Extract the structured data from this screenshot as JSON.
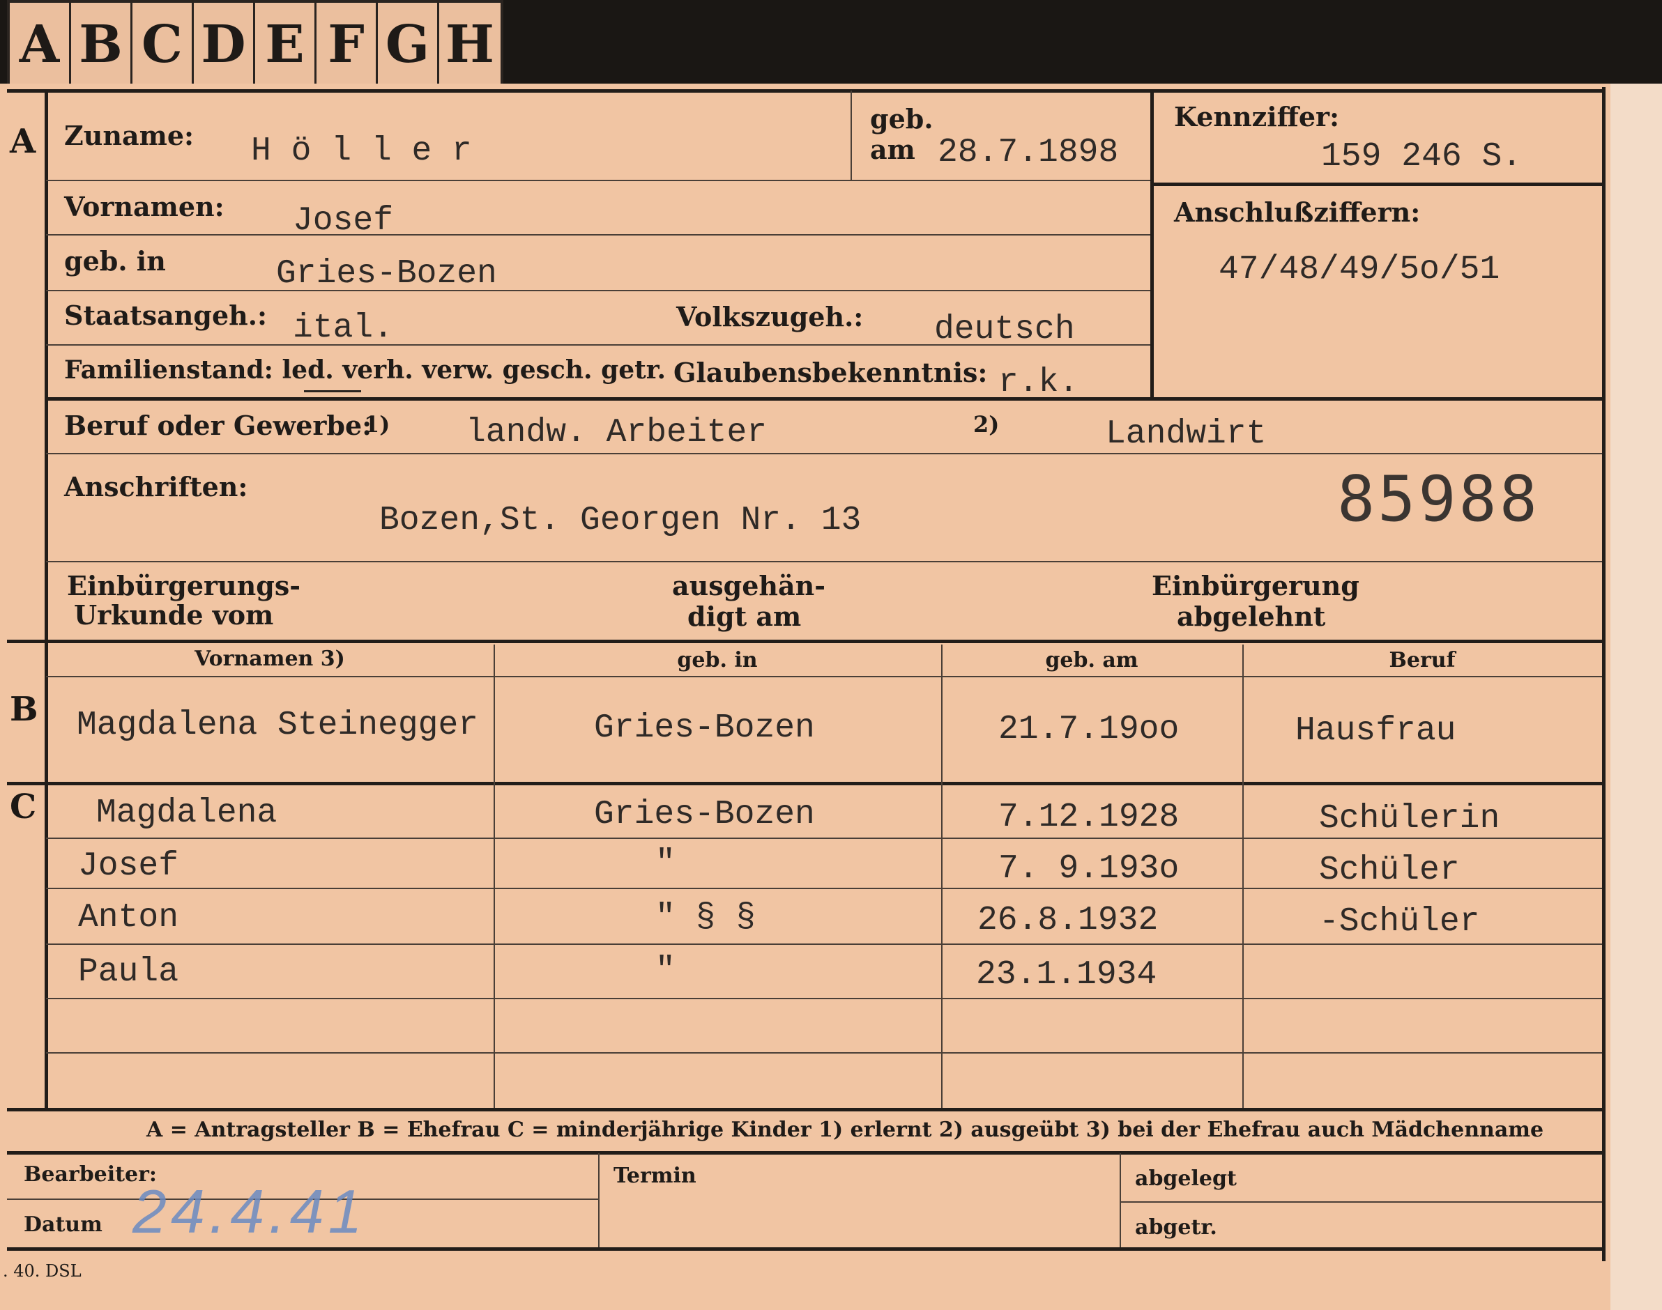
{
  "tabs": [
    "A",
    "B",
    "C",
    "D",
    "E",
    "F",
    "G",
    "H"
  ],
  "section_letters": {
    "a": "A",
    "b": "B",
    "c": "C"
  },
  "labels": {
    "zuname": "Zuname:",
    "geb": "geb.",
    "am": "am",
    "kennziffer": "Kennziffer:",
    "vornamen": "Vornamen:",
    "geb_in": "geb. in",
    "anschlussziffern": "Anschlußziffern:",
    "staatsangeh": "Staatsangeh.:",
    "volkszugeh": "Volkszugeh.:",
    "familienstand": "Familienstand: led. verh. verw. gesch. getr.",
    "glaubensbekenntnis": "Glaubensbekenntnis:",
    "beruf": "Beruf oder Gewerbe:",
    "fn1": "1)",
    "fn2": "2)",
    "anschriften": "Anschriften:",
    "einb_urkunde_1": "Einbürgerungs-",
    "einb_urkunde_2": "Urkunde vom",
    "ausgehaendigt_1": "ausgehän-",
    "ausgehaendigt_2": "digt am",
    "einb_abgelehnt_1": "Einbürgerung",
    "einb_abgelehnt_2": "abgelehnt",
    "bearbeiter": "Bearbeiter:",
    "termin": "Termin",
    "abgelegt": "abgelegt",
    "datum": "Datum",
    "abgetr": "abgetr.",
    "legend": "A = Antragsteller   B = Ehefrau   C = minderjährige Kinder   1) erlernt   2) ausgeübt   3) bei der Ehefrau auch Mädchenname",
    "form_no": ". 40. DSL"
  },
  "person": {
    "zuname": "H ö l l e r",
    "geb_am": "28.7.1898",
    "kennziffer": "159 246    S.",
    "vornamen": "Josef",
    "geb_in": "Gries-Bozen",
    "anschlussziffern": "47/48/49/5o/51",
    "staatsangeh": "ital.",
    "volkszugeh": "deutsch",
    "glaubensbekenntnis": "r.k.",
    "beruf_erlernt": "landw. Arbeiter",
    "beruf_ausgeuebt": "Landwirt",
    "anschrift": "Bozen,St. Georgen Nr. 13",
    "number": "85988"
  },
  "table_headers": [
    "Vornamen 3)",
    "geb. in",
    "geb. am",
    "Beruf"
  ],
  "spouse": {
    "vornamen": "Magdalena Steinegger",
    "geb_in": "Gries-Bozen",
    "geb_am": "21.7.19oo",
    "beruf": "Hausfrau"
  },
  "children": [
    {
      "vornamen": "Magdalena",
      "geb_in": "Gries-Bozen",
      "geb_am": "7.12.1928",
      "beruf": "Schülerin"
    },
    {
      "vornamen": "Josef",
      "geb_in": "\"",
      "geb_am": "7. 9.193o",
      "beruf": "Schüler"
    },
    {
      "vornamen": "Anton",
      "geb_in": "\" §  §",
      "geb_am": "26.8.1932",
      "beruf": "-Schüler"
    },
    {
      "vornamen": "Paula",
      "geb_in": "\"",
      "geb_am": "23.1.1934",
      "beruf": ""
    },
    {
      "vornamen": "",
      "geb_in": "",
      "geb_am": "",
      "beruf": ""
    },
    {
      "vornamen": "",
      "geb_in": "",
      "geb_am": "",
      "beruf": ""
    }
  ],
  "footer": {
    "datum_value": "24.4.41"
  }
}
